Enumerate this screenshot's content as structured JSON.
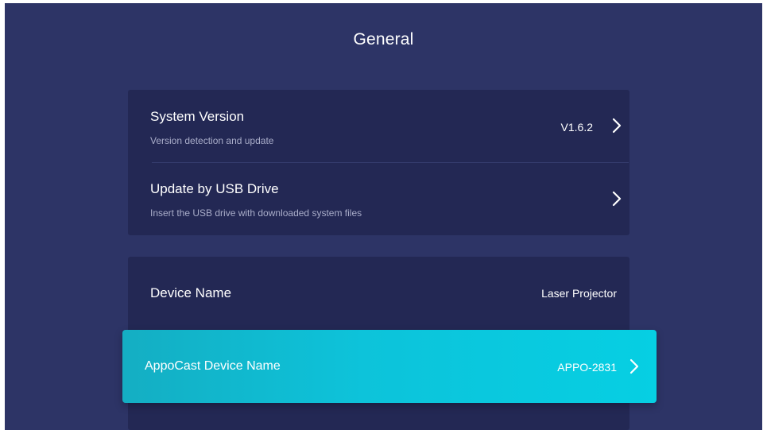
{
  "page": {
    "title": "General"
  },
  "system_group": {
    "items": [
      {
        "title": "System Version",
        "subtitle": "Version detection and update",
        "value": "V1.6.2",
        "chevron_icon": "chevron-right-icon"
      },
      {
        "title": "Update by USB Drive",
        "subtitle": "Insert the USB drive with downloaded system files",
        "chevron_icon": "chevron-right-icon"
      }
    ]
  },
  "device_group": {
    "items": [
      {
        "title": "Device Name",
        "value": "Laser Projector"
      },
      {
        "title": "AppoCast Device Name",
        "value": "APPO-2831",
        "chevron_icon": "chevron-right-icon",
        "focused": "true"
      }
    ]
  },
  "colors": {
    "background": "#2d3466",
    "card": "#232854",
    "focus": "#0dc3da",
    "text": "#ffffff",
    "subtext": "#a9adc9"
  }
}
